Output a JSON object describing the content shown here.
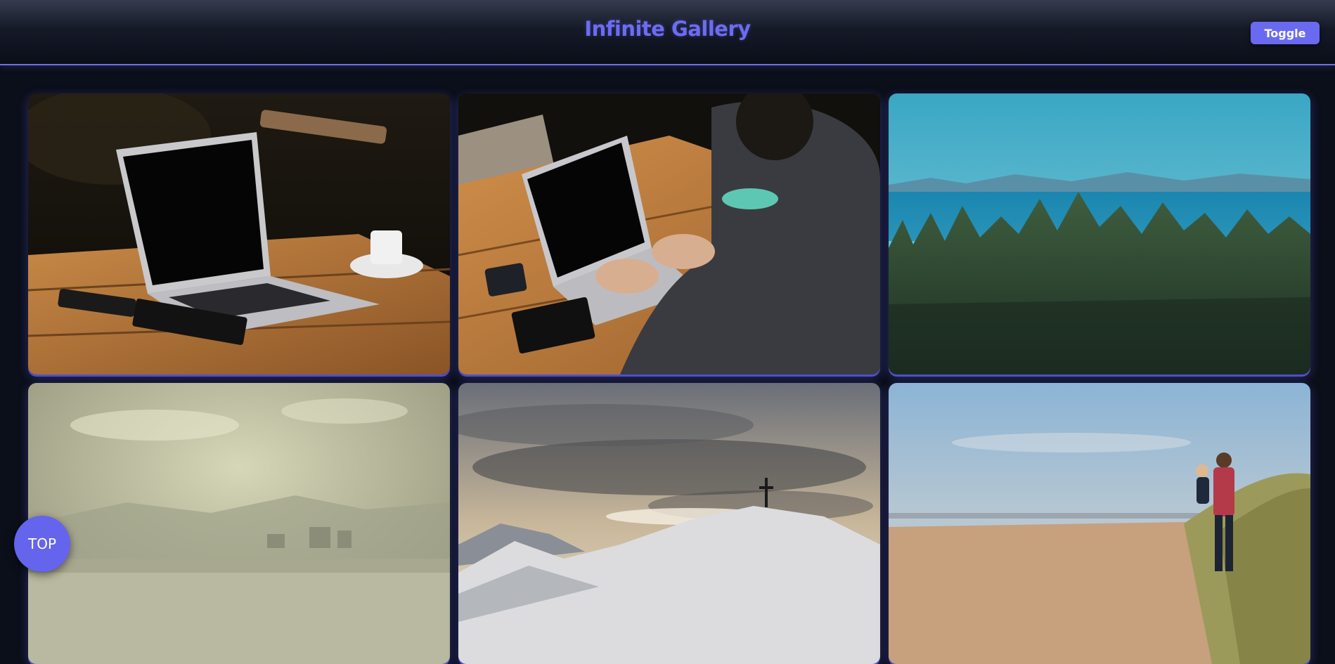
{
  "header": {
    "title": "Infinite Gallery",
    "toggle_label": "Toggle"
  },
  "gallery": {
    "images": [
      {
        "subject": "laptop on wooden table with phone, notebook and coffee cup"
      },
      {
        "subject": "man typing on laptop at wooden table"
      },
      {
        "subject": "pine forest overlooking blue sea and mountains"
      },
      {
        "subject": "hazy beach shoreline with city in distance"
      },
      {
        "subject": "cross on snowy mountain peak under cloudy sky"
      },
      {
        "subject": "man carrying child walking on beach dunes"
      }
    ]
  },
  "scroll_top": {
    "label": "TOP"
  },
  "colors": {
    "accent": "#6a6af0",
    "background": "#0b0f1a"
  }
}
